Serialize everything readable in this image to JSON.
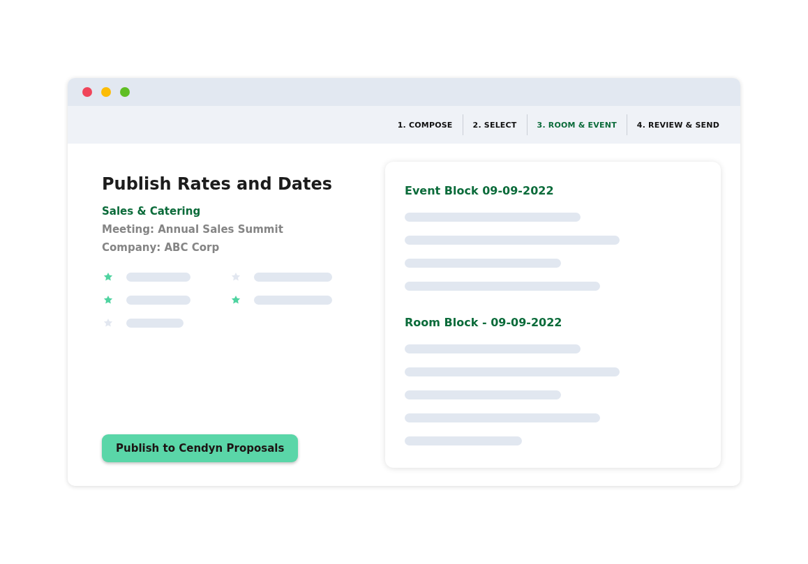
{
  "steps": [
    {
      "label": "1.  COMPOSE",
      "selected": false
    },
    {
      "label": "2.  SELECT",
      "selected": false
    },
    {
      "label": "3.  ROOM & EVENT",
      "selected": true
    },
    {
      "label": "4.  REVIEW & SEND",
      "selected": false
    }
  ],
  "title": "Publish Rates and Dates",
  "subtitle": "Sales & Catering",
  "details": [
    "Meeting: Annual Sales Summit",
    "Company: ABC Corp"
  ],
  "options": [
    {
      "starred": true
    },
    {
      "starred": false
    },
    {
      "starred": true
    },
    {
      "starred": true
    },
    {
      "starred": false
    }
  ],
  "publish_button": "Publish to Cendyn Proposals",
  "blocks": [
    {
      "title": "Event Block 09-09-2022"
    },
    {
      "title": "Room Block - 09-09-2022"
    }
  ]
}
